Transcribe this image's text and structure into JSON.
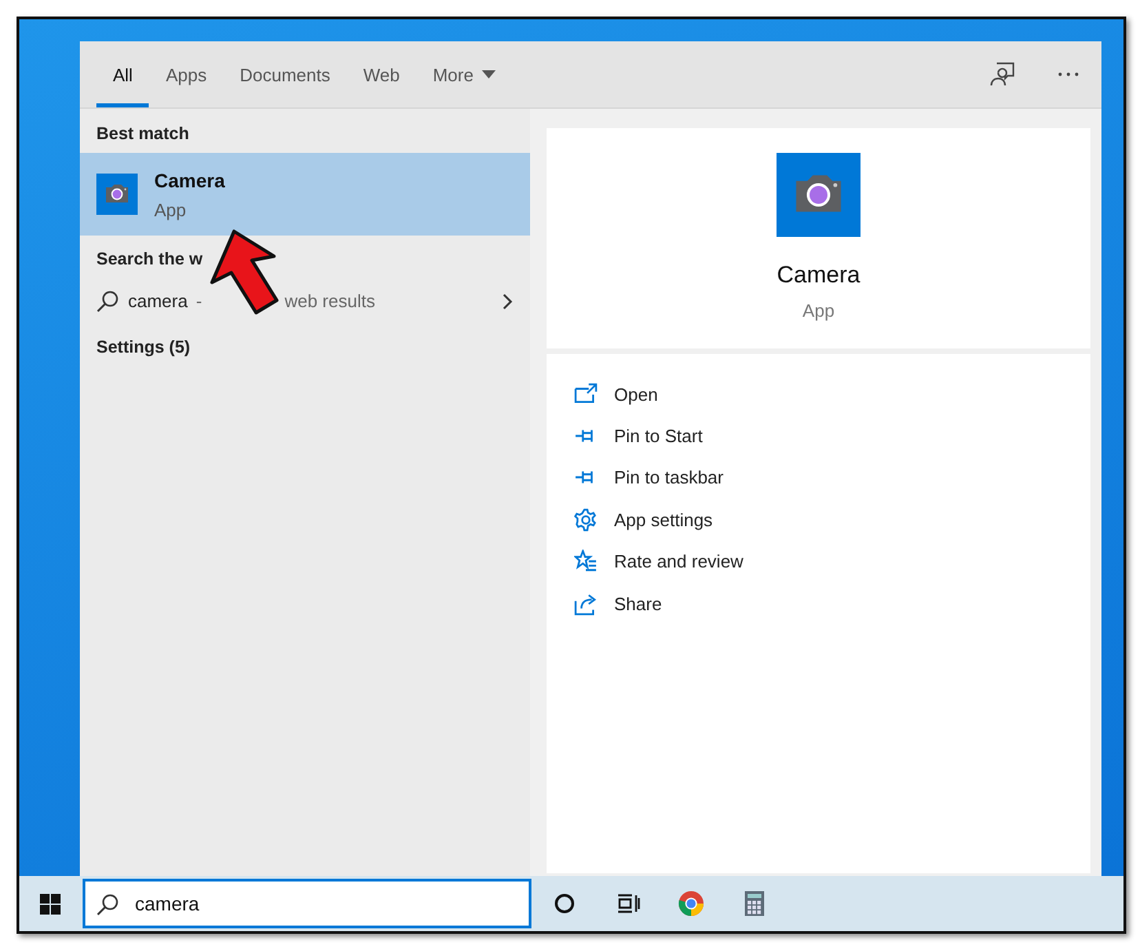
{
  "tabs": [
    {
      "label": "All",
      "selected": true
    },
    {
      "label": "Apps",
      "selected": false
    },
    {
      "label": "Documents",
      "selected": false
    },
    {
      "label": "Web",
      "selected": false
    },
    {
      "label": "More",
      "selected": false,
      "kind": "dropdown"
    }
  ],
  "results": {
    "best_match_heading": "Best match",
    "best_match": {
      "title": "Camera",
      "subtitle": "App",
      "selected": true
    },
    "web_heading": "Search the w",
    "web_result": {
      "query": "camera",
      "text_1": "-",
      "text_2": "web results"
    },
    "settings": "Settings (5)"
  },
  "detail": {
    "title": "Camera",
    "subtitle": "App",
    "actions": [
      {
        "label": "Open",
        "kind": "open"
      },
      {
        "label": "Pin to Start",
        "kind": "pin"
      },
      {
        "label": "Pin to taskbar",
        "kind": "pin"
      },
      {
        "label": "App settings",
        "kind": "settings"
      },
      {
        "label": "Rate and review",
        "kind": "rate"
      },
      {
        "label": "Share",
        "kind": "share"
      }
    ]
  },
  "taskbar": {
    "search": {
      "value": "camera"
    },
    "apps": [
      {
        "kind": "cortana"
      },
      {
        "kind": "taskview"
      },
      {
        "kind": "chrome"
      },
      {
        "kind": "calculator"
      }
    ]
  }
}
